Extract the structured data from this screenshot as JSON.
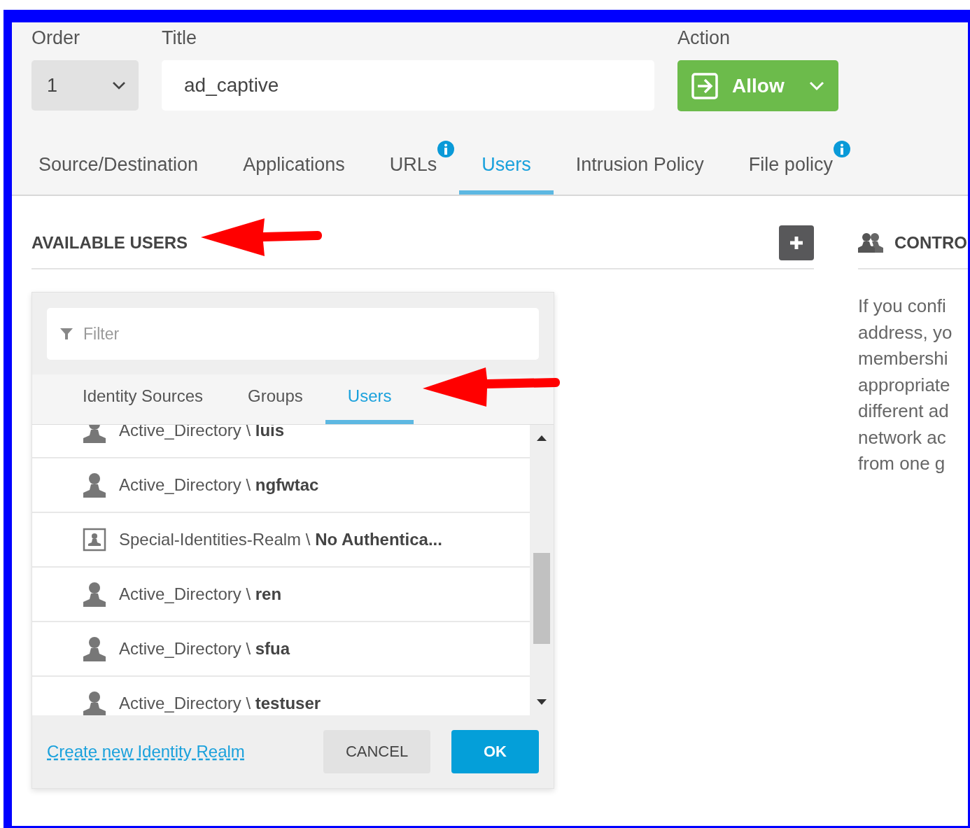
{
  "header": {
    "order": {
      "label": "Order",
      "value": "1"
    },
    "title": {
      "label": "Title",
      "value": "ad_captive"
    },
    "action": {
      "label": "Action",
      "value": "Allow"
    }
  },
  "tabs": [
    {
      "label": "Source/Destination",
      "selected": false,
      "info": false
    },
    {
      "label": "Applications",
      "selected": false,
      "info": false
    },
    {
      "label": "URLs",
      "selected": false,
      "info": true
    },
    {
      "label": "Users",
      "selected": true,
      "info": false
    },
    {
      "label": "Intrusion Policy",
      "selected": false,
      "info": false
    },
    {
      "label": "File policy",
      "selected": false,
      "info": true
    }
  ],
  "available": {
    "heading": "AVAILABLE USERS"
  },
  "picker": {
    "filter": {
      "placeholder": "Filter"
    },
    "tabs": [
      {
        "label": "Identity Sources",
        "selected": false
      },
      {
        "label": "Groups",
        "selected": false
      },
      {
        "label": "Users",
        "selected": true
      }
    ],
    "items": [
      {
        "kind": "user",
        "text": "Active_Directory \\ **luis**"
      },
      {
        "kind": "user",
        "text": "Active_Directory \\ **ngfwtac**"
      },
      {
        "kind": "special",
        "text": "Special-Identities-Realm \\ **No Authentica...**"
      },
      {
        "kind": "user",
        "text": "Active_Directory \\ **ren**"
      },
      {
        "kind": "user",
        "text": "Active_Directory \\ **sfua**"
      },
      {
        "kind": "user",
        "text": "Active_Directory \\ **testuser**"
      }
    ],
    "link": "Create new Identity Realm",
    "cancel": "CANCEL",
    "ok": "OK"
  },
  "controlled": {
    "heading": "CONTRO",
    "lines": [
      "If you confi",
      "address, yo",
      "membershi",
      "appropriate",
      "different ad",
      "network ac",
      "from one g"
    ]
  }
}
